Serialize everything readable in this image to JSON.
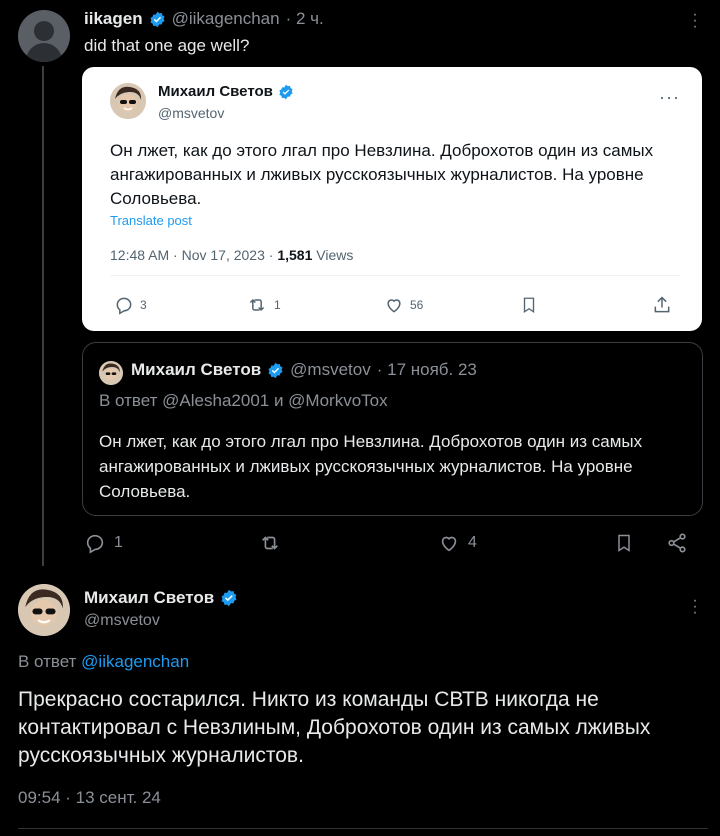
{
  "reply": {
    "name": "iikagen",
    "handle": "@iikagenchan",
    "time": "· 2 ч.",
    "text": "did that one age well?"
  },
  "screenshot_card": {
    "name": "Михаил Светов",
    "handle": "@msvetov",
    "text": "Он лжет, как до этого лгал про Невзлина. Доброхотов один из самых ангажированных и лживых русскоязычных журналистов. На уровне Соловьева.",
    "translate": "Translate post",
    "time": "12:48 AM · Nov 17, 2023 · ",
    "views_count": "1,581",
    "views_label": " Views",
    "replies": "3",
    "retweets": "1",
    "likes": "56"
  },
  "quote_card": {
    "name": "Михаил Светов",
    "handle": "@msvetov",
    "time": "· 17 нояб. 23",
    "reply_to": "В ответ @Alesha2001 и @MorkvoTox",
    "text": "Он лжет, как до этого лгал про Невзлина. Доброхотов один из самых ангажированных и лживых русскоязычных журналистов. На уровне Соловьева."
  },
  "reply_actions": {
    "replies": "1",
    "likes": "4"
  },
  "main_tweet": {
    "name": "Михаил Светов",
    "handle": "@msvetov",
    "reply_to_prefix": "В ответ ",
    "reply_to_link": "@iikagenchan",
    "text": "Прекрасно состарился. Никто из команды СВТВ никогда не контактировал с Невзлиным, Доброхотов один из самых лживых русскоязычных журналистов.",
    "time": "09:54 · 13 сент. 24"
  },
  "colors": {
    "background": "#000000",
    "accent": "#1d9bf0",
    "muted": "#8b9097"
  }
}
